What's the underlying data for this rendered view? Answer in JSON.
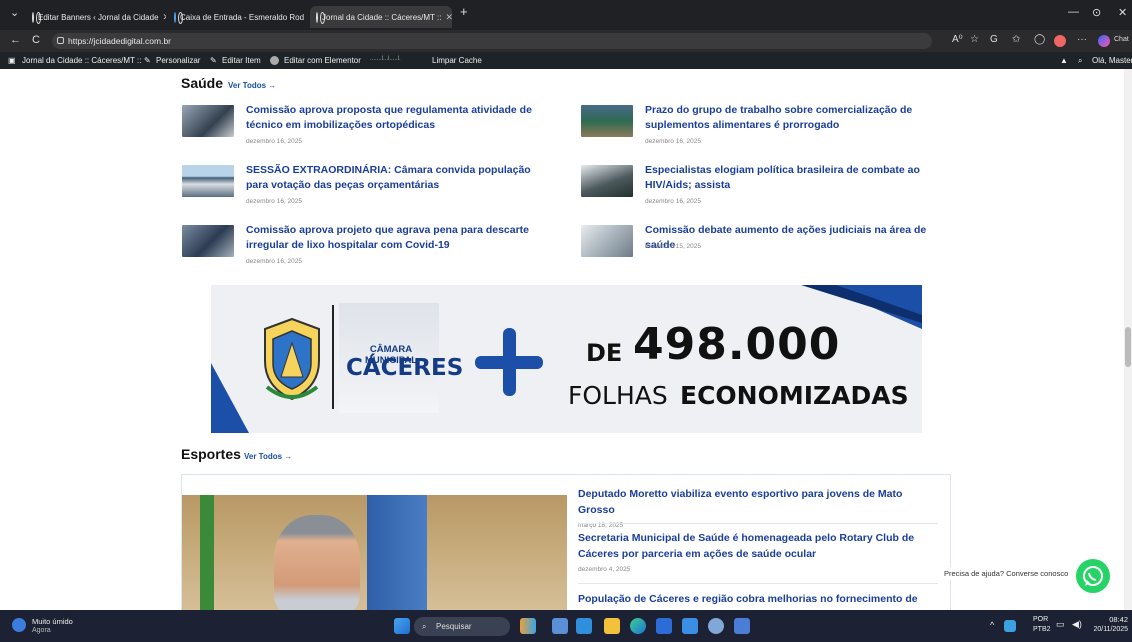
{
  "browser": {
    "tabs": [
      {
        "label": "Editar Banners ‹ Jornal da Cidade"
      },
      {
        "label": "Caixa de Entrada - Esmeraldo Rod"
      },
      {
        "label": "Jornal da Cidade :: Cáceres/MT ::"
      }
    ],
    "url": "https://jcidadedigital.com.br",
    "chat_label": "Chat"
  },
  "wpbar": {
    "site": "Jornal da Cidade :: Cáceres/MT ::",
    "personalize": "Personalizar",
    "edit_item": "Editar Item",
    "elementor": "Editar com Elementor",
    "clear_cache": "Limpar Cache",
    "greeting": "Olá, Master"
  },
  "saude": {
    "title": "Saúde",
    "ver_todos": "Ver Todos →",
    "items": [
      {
        "title": "Comissão aprova proposta que regulamenta atividade de técnico em imobilizações ortopédicas",
        "date": "dezembro 16, 2025"
      },
      {
        "title": "Prazo do grupo de trabalho sobre comercialização de suplementos alimentares é prorrogado",
        "date": "dezembro 16, 2025"
      },
      {
        "title": "SESSÃO EXTRAORDINÁRIA: Câmara convida população para votação das peças orçamentárias",
        "date": "dezembro 16, 2025"
      },
      {
        "title": "Especialistas elogiam política brasileira de combate ao HIV/Aids; assista",
        "date": "dezembro 16, 2025"
      },
      {
        "title": "Comissão aprova projeto que agrava pena para descarte irregular de lixo hospitalar com Covid-19",
        "date": "dezembro 16, 2025"
      },
      {
        "title": "Comissão debate aumento de ações judiciais na área de saúde",
        "date": "dezembro 15, 2025"
      }
    ]
  },
  "banner": {
    "org_top": "CÂMARA MUNICIPAL",
    "org_name": "CÁCERES",
    "prefix": "DE",
    "number": "498.000",
    "line2_a": "FOLHAS",
    "line2_b": "ECONOMIZADAS"
  },
  "esportes": {
    "title": "Esportes",
    "ver_todos": "Ver Todos →",
    "items": [
      {
        "title": "Deputado Moretto viabiliza evento esportivo para jovens de Mato Grosso",
        "date": "março 18, 2025"
      },
      {
        "title": "Secretaria Municipal de Saúde é homenageada pelo Rotary Club de Cáceres por parceria em ações de saúde ocular",
        "date": "dezembro 4, 2025"
      },
      {
        "title": "População de Cáceres e região cobra melhorias no fornecimento de",
        "date": ""
      }
    ]
  },
  "help_text": "Precisa de ajuda? Converse conosco",
  "taskbar": {
    "weather": "Muito úmido",
    "weather_sub": "Agora",
    "search": "Pesquisar",
    "lang": "POR",
    "lang2": "PTB2",
    "time": "08:42",
    "date": "20/11/2025"
  },
  "colors": {
    "link": "#1b3e9b",
    "brand_blue": "#1b4fa8",
    "whatsapp": "#25d366"
  }
}
